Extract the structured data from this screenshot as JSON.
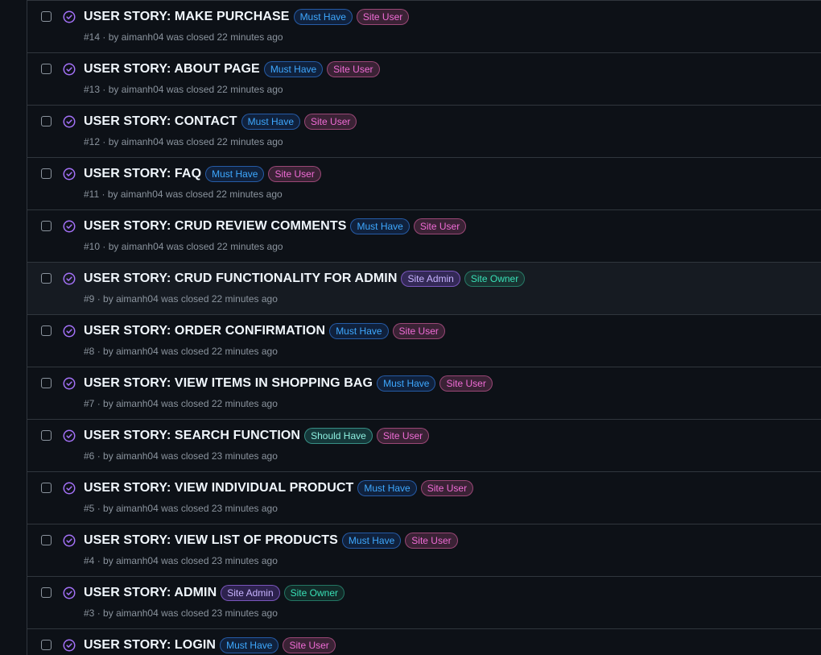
{
  "issues": [
    {
      "title": "USER STORY: MAKE PURCHASE",
      "number": "#14",
      "author": "aimanh04",
      "closed": "was closed 22 minutes ago",
      "labels": [
        {
          "text": "Must Have",
          "kind": "must"
        },
        {
          "text": "Site User",
          "kind": "user"
        }
      ]
    },
    {
      "title": "USER STORY: ABOUT PAGE",
      "number": "#13",
      "author": "aimanh04",
      "closed": "was closed 22 minutes ago",
      "labels": [
        {
          "text": "Must Have",
          "kind": "must"
        },
        {
          "text": "Site User",
          "kind": "user"
        }
      ]
    },
    {
      "title": "USER STORY: CONTACT",
      "number": "#12",
      "author": "aimanh04",
      "closed": "was closed 22 minutes ago",
      "labels": [
        {
          "text": "Must Have",
          "kind": "must"
        },
        {
          "text": "Site User",
          "kind": "user"
        }
      ]
    },
    {
      "title": "USER STORY: FAQ",
      "number": "#11",
      "author": "aimanh04",
      "closed": "was closed 22 minutes ago",
      "labels": [
        {
          "text": "Must Have",
          "kind": "must"
        },
        {
          "text": "Site User",
          "kind": "user"
        }
      ]
    },
    {
      "title": "USER STORY: CRUD REVIEW COMMENTS",
      "number": "#10",
      "author": "aimanh04",
      "closed": "was closed 22 minutes ago",
      "labels": [
        {
          "text": "Must Have",
          "kind": "must"
        },
        {
          "text": "Site User",
          "kind": "user"
        }
      ]
    },
    {
      "title": "USER STORY: CRUD FUNCTIONALITY FOR ADMIN",
      "number": "#9",
      "author": "aimanh04",
      "closed": "was closed 22 minutes ago",
      "hover": true,
      "labels": [
        {
          "text": "Site Admin",
          "kind": "admin"
        },
        {
          "text": "Site Owner",
          "kind": "owner"
        }
      ]
    },
    {
      "title": "USER STORY: ORDER CONFIRMATION",
      "number": "#8",
      "author": "aimanh04",
      "closed": "was closed 22 minutes ago",
      "labels": [
        {
          "text": "Must Have",
          "kind": "must"
        },
        {
          "text": "Site User",
          "kind": "user"
        }
      ]
    },
    {
      "title": "USER STORY: VIEW ITEMS IN SHOPPING BAG",
      "number": "#7",
      "author": "aimanh04",
      "closed": "was closed 22 minutes ago",
      "labels": [
        {
          "text": "Must Have",
          "kind": "must"
        },
        {
          "text": "Site User",
          "kind": "user"
        }
      ]
    },
    {
      "title": "USER STORY: SEARCH FUNCTION",
      "number": "#6",
      "author": "aimanh04",
      "closed": "was closed 23 minutes ago",
      "labels": [
        {
          "text": "Should Have",
          "kind": "should"
        },
        {
          "text": "Site User",
          "kind": "user"
        }
      ]
    },
    {
      "title": "USER STORY: VIEW INDIVIDUAL PRODUCT",
      "number": "#5",
      "author": "aimanh04",
      "closed": "was closed 23 minutes ago",
      "labels": [
        {
          "text": "Must Have",
          "kind": "must"
        },
        {
          "text": "Site User",
          "kind": "user"
        }
      ]
    },
    {
      "title": "USER STORY: VIEW LIST OF PRODUCTS",
      "number": "#4",
      "author": "aimanh04",
      "closed": "was closed 23 minutes ago",
      "labels": [
        {
          "text": "Must Have",
          "kind": "must"
        },
        {
          "text": "Site User",
          "kind": "user"
        }
      ]
    },
    {
      "title": "USER STORY: ADMIN",
      "number": "#3",
      "author": "aimanh04",
      "closed": "was closed 23 minutes ago",
      "labels": [
        {
          "text": "Site Admin",
          "kind": "admin"
        },
        {
          "text": "Site Owner",
          "kind": "owner"
        }
      ]
    },
    {
      "title": "USER STORY: LOGIN",
      "number": "",
      "author": "",
      "closed": "",
      "labels": [
        {
          "text": "Must Have",
          "kind": "must"
        },
        {
          "text": "Site User",
          "kind": "user"
        }
      ]
    }
  ],
  "meta_by": "by",
  "meta_sep": "·",
  "icons": {
    "state": "issue-closed-completed-icon",
    "checkbox": "checkbox"
  },
  "colors": {
    "background": "#0d1117",
    "border": "#30363d",
    "completed": "#a371f7",
    "muted": "#8b949e"
  }
}
